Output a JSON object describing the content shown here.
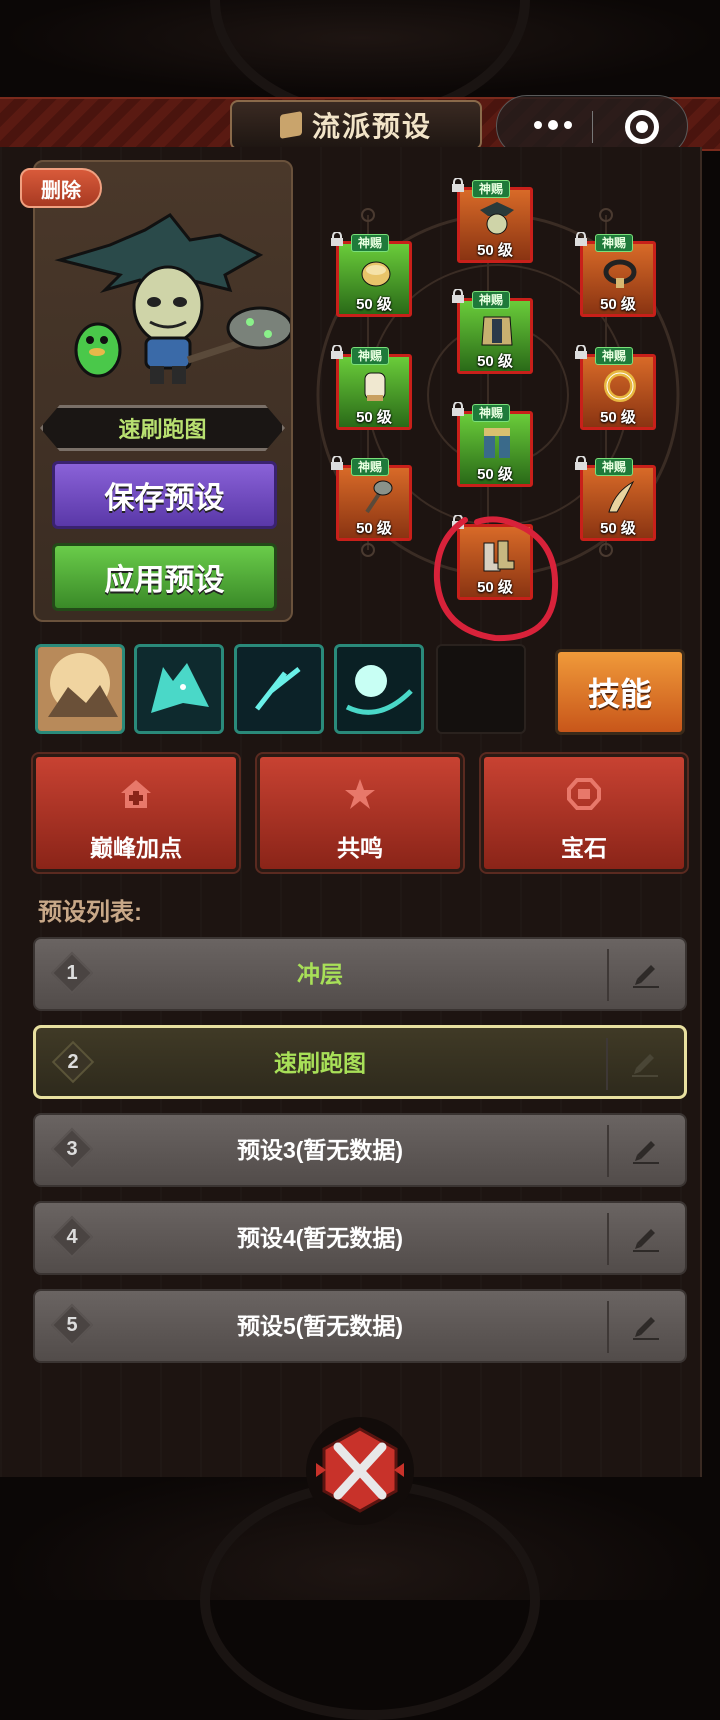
{
  "header": {
    "title": "流派预设",
    "capsule": {
      "more_icon": "more-dots-icon",
      "close_icon": "target-circle-icon"
    }
  },
  "hero": {
    "delete_label": "删除",
    "preset_name": "速刷跑图",
    "save_label": "保存预设",
    "apply_label": "应用预设"
  },
  "equipment": {
    "tag": "神赐",
    "slots": [
      {
        "id": "helmet",
        "color": "orange",
        "level": "50 级",
        "icon": "crow-helm-icon"
      },
      {
        "id": "shoulder",
        "color": "green",
        "level": "50 级",
        "icon": "shoulder-armor-icon"
      },
      {
        "id": "necklace",
        "color": "orange",
        "level": "50 级",
        "icon": "necklace-icon"
      },
      {
        "id": "chest",
        "color": "green",
        "level": "50 级",
        "icon": "chest-armor-icon"
      },
      {
        "id": "gloves",
        "color": "green",
        "level": "50 级",
        "icon": "gauntlet-icon"
      },
      {
        "id": "ring",
        "color": "orange",
        "level": "50 级",
        "icon": "ring-icon"
      },
      {
        "id": "pants",
        "color": "green",
        "level": "50 级",
        "icon": "leg-armor-icon"
      },
      {
        "id": "weapon",
        "color": "orange",
        "level": "50 级",
        "icon": "mace-icon"
      },
      {
        "id": "offhand",
        "color": "orange",
        "level": "50 级",
        "icon": "horn-icon"
      },
      {
        "id": "boots",
        "color": "orange",
        "level": "50 级",
        "icon": "boots-icon",
        "circled": true
      }
    ]
  },
  "skills": {
    "icons": [
      "rock-skill-icon",
      "wolf-skill-icon",
      "lightning-skill-icon",
      "orb-skill-icon"
    ],
    "button_label": "技能"
  },
  "actions": [
    {
      "label": "巅峰加点",
      "icon": "peak-house-icon"
    },
    {
      "label": "共鸣",
      "icon": "resonance-star-icon"
    },
    {
      "label": "宝石",
      "icon": "gem-icon"
    }
  ],
  "preset_list": {
    "title": "预设列表:",
    "items": [
      {
        "num": "1",
        "label": "冲层",
        "active": false,
        "green": true
      },
      {
        "num": "2",
        "label": "速刷跑图",
        "active": true,
        "green": true
      },
      {
        "num": "3",
        "label": "预设3(暂无数据)",
        "active": false,
        "green": false
      },
      {
        "num": "4",
        "label": "预设4(暂无数据)",
        "active": false,
        "green": false
      },
      {
        "num": "5",
        "label": "预设5(暂无数据)",
        "active": false,
        "green": false
      }
    ],
    "edit_icon": "pencil-icon"
  },
  "colors": {
    "accent_red": "#c84232",
    "save_purple": "#7a52c8",
    "apply_green": "#4aa830",
    "skill_orange": "#e07a2a",
    "preset_green_text": "#a8e058"
  }
}
